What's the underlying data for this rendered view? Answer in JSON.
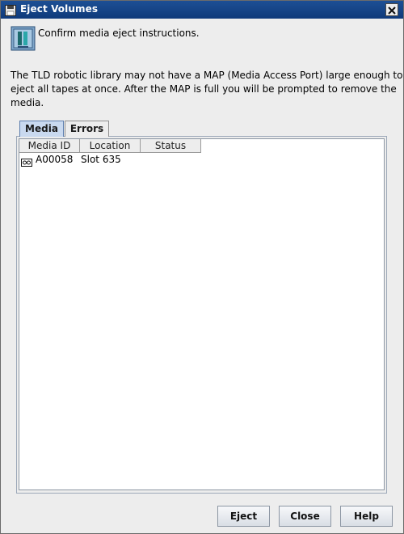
{
  "window": {
    "title": "Eject Volumes",
    "title_icon": "floppy-disk-icon",
    "close_icon": "close-icon"
  },
  "header": {
    "icon": "tape-library-icon",
    "text": "Confirm media eject instructions."
  },
  "description": {
    "lines": [
      "The TLD robotic library may not have a MAP (Media Access Port) large enough to",
      "eject all tapes at once.  After the MAP is full you will be prompted to remove the",
      "media."
    ]
  },
  "tabs": [
    {
      "label": "Media",
      "selected": true
    },
    {
      "label": "Errors",
      "selected": false
    }
  ],
  "table": {
    "columns": [
      "Media ID",
      "Location",
      "Status"
    ],
    "rows": [
      {
        "icon": "tape-cartridge-icon",
        "media_id": "A00058",
        "location": "Slot 635",
        "status": ""
      }
    ]
  },
  "buttons": {
    "eject": "Eject",
    "close": "Close",
    "help": "Help"
  },
  "colors": {
    "titlebar": "#1d4f95",
    "selected_tab": "#c9d9ef"
  }
}
